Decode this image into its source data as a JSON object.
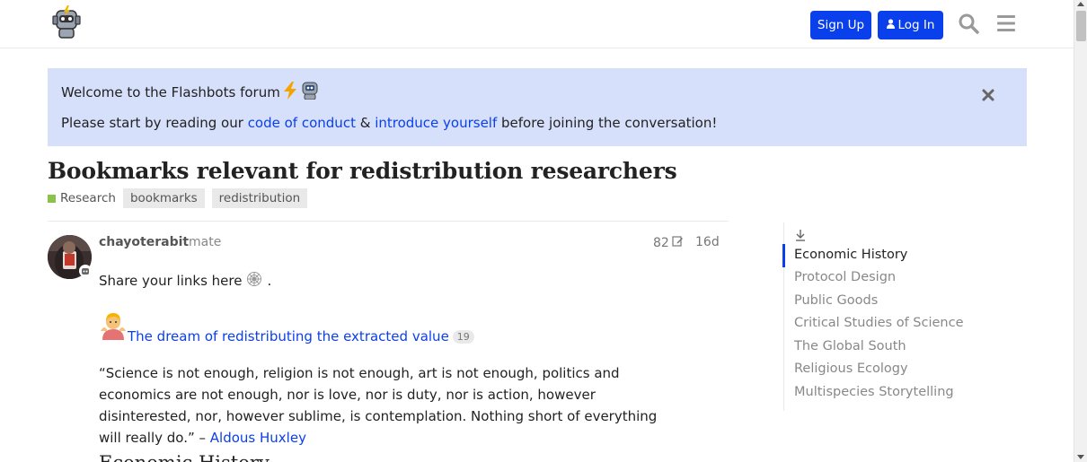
{
  "header": {
    "signup_label": "Sign Up",
    "login_label": "Log In",
    "accent": "#0a3fec"
  },
  "banner": {
    "title": "Welcome to the Flashbots forum",
    "text_prefix": "Please start by reading our ",
    "link1": "code of conduct",
    "text_mid": " & ",
    "link2": "introduce yourself",
    "text_suffix": " before joining the conversation!",
    "bg_color": "#d6e0fb"
  },
  "topic": {
    "title": "Bookmarks relevant for redistribution researchers",
    "category": "Research",
    "category_color": "#8bc34a",
    "tags": [
      "bookmarks",
      "redistribution"
    ]
  },
  "post": {
    "username": "chayoterabit",
    "user_title": "mate",
    "edit_count": "82",
    "date": "16d",
    "share_text": "Share your links here",
    "share_suffix": ".",
    "dream_link": "The dream of redistributing the extracted value",
    "dream_clicks": "19",
    "quote": "“Science is not enough, religion is not enough, art is not enough, politics and economics are not enough, nor is love, nor is duty, nor is action, however disinterested, nor, however sublime, is contemplation. Nothing short of everything will really do.” – ",
    "quote_author": "Aldous Huxley",
    "section_heading": "Economic History"
  },
  "toc": {
    "items": [
      "Economic History",
      "Protocol Design",
      "Public Goods",
      "Critical Studies of Science",
      "The Global South",
      "Religious Ecology",
      "Multispecies Storytelling"
    ],
    "active_index": 0
  }
}
